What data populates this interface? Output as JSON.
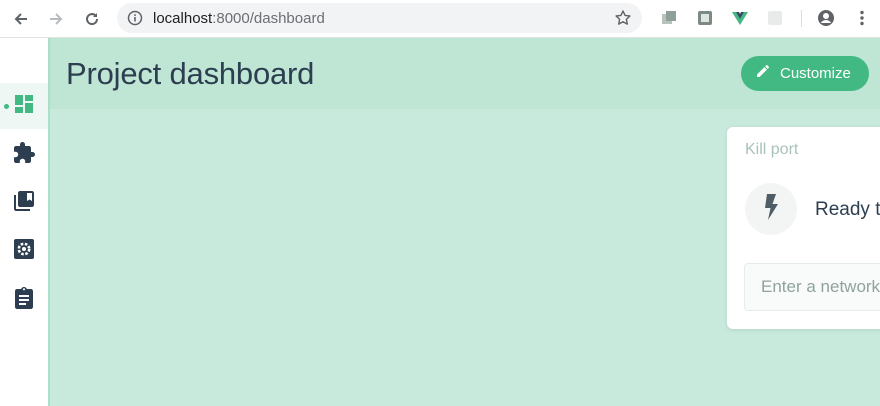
{
  "browser": {
    "url_host": "localhost",
    "url_rest": ":8000/dashboard",
    "icons": [
      "back-icon",
      "forward-icon",
      "reload-icon",
      "info-icon",
      "bookmark-star-icon",
      "profile-icon",
      "more-icon"
    ]
  },
  "sidebar": {
    "items": [
      {
        "icon": "dashboard-icon",
        "active": true
      },
      {
        "icon": "plugins-icon",
        "active": false
      },
      {
        "icon": "dependencies-icon",
        "active": false
      },
      {
        "icon": "configuration-icon",
        "active": false
      },
      {
        "icon": "tasks-icon",
        "active": false
      }
    ]
  },
  "header": {
    "title": "Project dashboard",
    "customize_label": "Customize"
  },
  "widget": {
    "title": "Kill port",
    "status": "Ready to kill",
    "input_placeholder": "Enter a network port"
  },
  "colors": {
    "accent": "#42b983",
    "header_bg": "#bfe6d4",
    "content_bg": "#c8eadc",
    "text": "#2c3e50"
  }
}
